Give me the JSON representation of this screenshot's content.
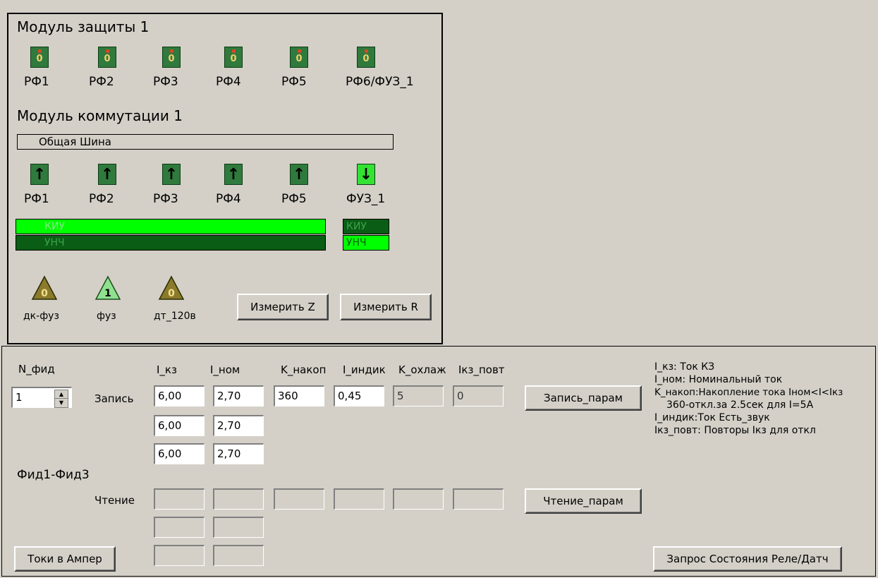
{
  "protection": {
    "title": "Модуль защиты 1",
    "relays": [
      {
        "label": "РФ1",
        "value": "0"
      },
      {
        "label": "РФ2",
        "value": "0"
      },
      {
        "label": "РФ3",
        "value": "0"
      },
      {
        "label": "РФ4",
        "value": "0"
      },
      {
        "label": "РФ5",
        "value": "0"
      },
      {
        "label": "РФ6/ФУЗ_1",
        "value": "0"
      }
    ]
  },
  "commutation": {
    "title": "Модуль коммутации 1",
    "bus_label": "Общая Шина",
    "switches": [
      {
        "label": "РФ1",
        "state": "up"
      },
      {
        "label": "РФ2",
        "state": "up"
      },
      {
        "label": "РФ3",
        "state": "up"
      },
      {
        "label": "РФ4",
        "state": "up"
      },
      {
        "label": "РФ5",
        "state": "up"
      },
      {
        "label": "ФУЗ_1",
        "state": "down"
      }
    ],
    "bar_kiu": "КИУ",
    "bar_unch": "УНЧ",
    "mini_kiu": "КИУ",
    "mini_unch": "УНЧ"
  },
  "alarms": [
    {
      "label": "дк-фуз",
      "value": "0",
      "color": "#8a7a2a"
    },
    {
      "label": "фуз",
      "value": "1",
      "color": "#8fe08f"
    },
    {
      "label": "дт_120в",
      "value": "0",
      "color": "#8a7a2a"
    }
  ],
  "buttons": {
    "measure_z": "Измерить Z",
    "measure_r": "Измерить R",
    "write_params": "Запись_парам",
    "read_params": "Чтение_парам",
    "currents_amp": "Токи в Ампер",
    "status_request": "Запрос Состояния Реле/Датч"
  },
  "params": {
    "n_fid_label": "N_фид",
    "n_fid_value": "1",
    "columns": [
      "I_кз",
      "I_ном",
      "K_накоп",
      "I_индик",
      "K_охлаж",
      "Iкз_повт"
    ],
    "write_label": "Запись",
    "write_row1": [
      "6,00",
      "2,70",
      "360",
      "0,45",
      "5",
      "0"
    ],
    "write_row2": [
      "6,00",
      "2,70"
    ],
    "write_row3": [
      "6,00",
      "2,70"
    ],
    "fid_range": "Фид1-Фид3",
    "read_label": "Чтение",
    "read_row1": [
      "",
      "",
      "",
      "",
      "",
      ""
    ],
    "read_row2": [
      "",
      ""
    ],
    "read_row3": [
      "",
      ""
    ]
  },
  "help": [
    "I_кз: Ток КЗ",
    "I_ном: Номинальный ток",
    "K_накоп:Накопление тока Iном<I<Iкз",
    "360-откл.за 2.5сек для I=5А",
    "I_индик:Ток Есть_звук",
    "Iкз_повт: Повторы Iкз для откл"
  ]
}
